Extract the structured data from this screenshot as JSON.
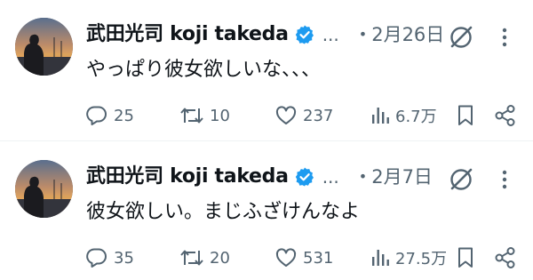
{
  "tweets": [
    {
      "author_name": "武田光司 koji takeda",
      "ellipsis": "...",
      "dot": "•",
      "date": "2月26日",
      "text": "やっぱり彼女欲しいな、、、",
      "replies": "25",
      "retweets": "10",
      "likes": "237",
      "views": "6.7万",
      "icons": [
        "verified-badge-icon",
        "grok-icon",
        "more-icon",
        "reply-icon",
        "retweet-icon",
        "like-icon",
        "views-icon",
        "bookmark-icon",
        "share-icon"
      ]
    },
    {
      "author_name": "武田光司 koji takeda",
      "ellipsis": "...",
      "dot": "•",
      "date": "2月7日",
      "text": "彼女欲しい。まじふざけんなよ",
      "replies": "35",
      "retweets": "20",
      "likes": "531",
      "views": "27.5万",
      "icons": [
        "verified-badge-icon",
        "grok-icon",
        "more-icon",
        "reply-icon",
        "retweet-icon",
        "like-icon",
        "views-icon",
        "bookmark-icon",
        "share-icon"
      ]
    }
  ],
  "colors": {
    "text_primary": "#0f1419",
    "text_secondary": "#536471",
    "verified_blue": "#1d9bf0",
    "divider": "#eff3f4"
  }
}
